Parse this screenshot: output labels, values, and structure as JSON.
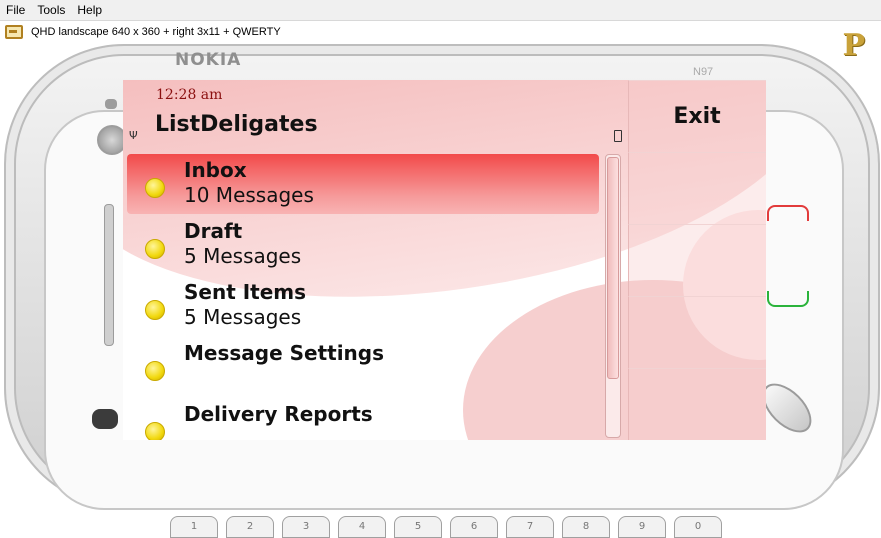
{
  "menubar": {
    "items": [
      "File",
      "Tools",
      "Help"
    ]
  },
  "toolbar": {
    "profile_label": "QHD landscape 640 x 360 + right 3x11 + QWERTY"
  },
  "branding": {
    "logo_text": "P",
    "device_brand": "NOKIA",
    "device_model": "N97"
  },
  "status": {
    "time": "12:28 am",
    "title": "ListDeligates"
  },
  "softkeys": {
    "exit_label": "Exit"
  },
  "list_items": [
    {
      "title": "Inbox",
      "subtitle": "10 Messages",
      "selected": true
    },
    {
      "title": "Draft",
      "subtitle": "5 Messages",
      "selected": false
    },
    {
      "title": "Sent Items",
      "subtitle": "5 Messages",
      "selected": false
    },
    {
      "title": "Message Settings",
      "subtitle": "",
      "selected": false
    },
    {
      "title": "Delivery Reports",
      "subtitle": "",
      "selected": false
    }
  ],
  "keyboard_keys": [
    "1",
    "2",
    "3",
    "4",
    "5",
    "6",
    "7",
    "8",
    "9",
    "0"
  ],
  "colors": {
    "highlight": "#f24a4a",
    "time_text": "#8b1010",
    "bullet": "#f1d80d",
    "end_call": "#e23b3b",
    "send_call": "#2ab33b"
  }
}
